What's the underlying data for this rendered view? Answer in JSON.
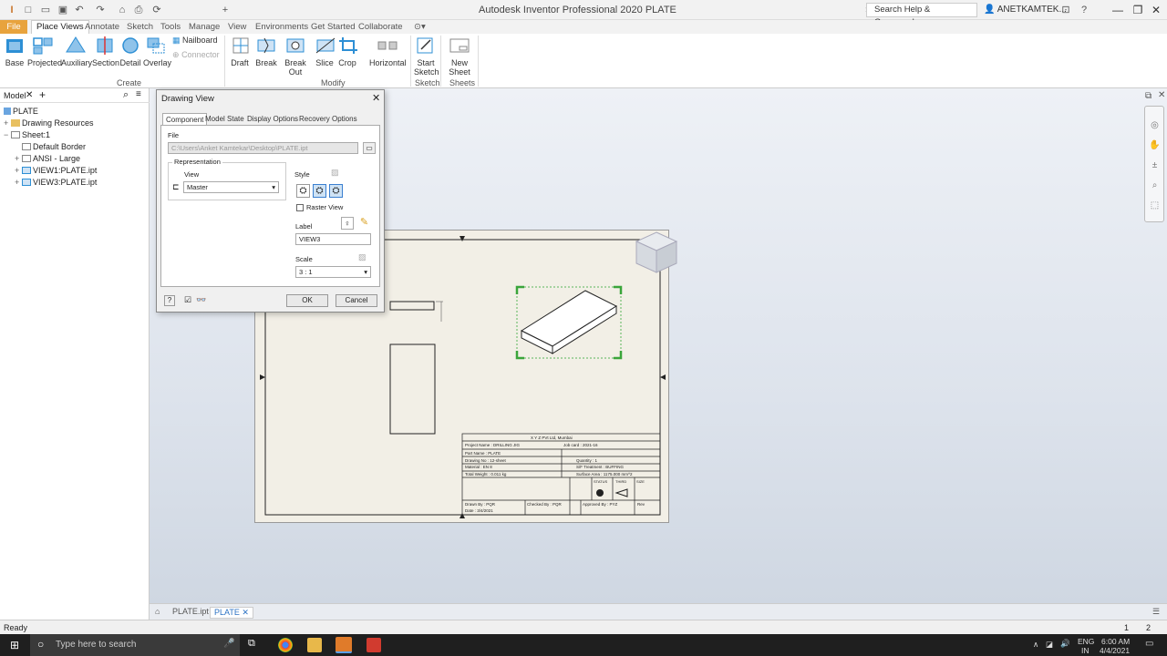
{
  "window": {
    "title": "Autodesk Inventor Professional 2020   PLATE",
    "help_search_placeholder": "Search Help & Commands...",
    "user": "ANETKAMTEK...",
    "minimize": "—",
    "restore": "❐",
    "close": "✕"
  },
  "ribbon_tabs": [
    "File",
    "Place Views",
    "Annotate",
    "Sketch",
    "Tools",
    "Manage",
    "View",
    "Environments",
    "Get Started",
    "Collaborate"
  ],
  "ribbon": {
    "create": {
      "title": "Create",
      "buttons": [
        "Base",
        "Projected",
        "Auxiliary",
        "Section",
        "Detail",
        "Overlay"
      ],
      "small": [
        "Nailboard",
        "Connector"
      ]
    },
    "modify": {
      "title": "Modify",
      "buttons": [
        "Draft",
        "Break",
        "Break Out",
        "Slice",
        "Crop",
        "Horizontal"
      ]
    },
    "sketch": {
      "title": "Sketch",
      "buttons": [
        "Start Sketch"
      ]
    },
    "sheets": {
      "title": "Sheets",
      "buttons": [
        "New Sheet"
      ]
    }
  },
  "browser": {
    "tab": "Model",
    "close": "✕",
    "add": "+",
    "items": [
      {
        "label": "PLATE",
        "expander": ""
      },
      {
        "label": "Drawing Resources",
        "expander": "+"
      },
      {
        "label": "Sheet:1",
        "expander": "−"
      },
      {
        "label": "Default Border",
        "expander": ""
      },
      {
        "label": "ANSI - Large",
        "expander": "+"
      },
      {
        "label": "VIEW1:PLATE.ipt",
        "expander": "+"
      },
      {
        "label": "VIEW3:PLATE.ipt",
        "expander": "+"
      }
    ]
  },
  "dialog": {
    "title": "Drawing View",
    "close": "✕",
    "tabs": [
      "Component",
      "Model State",
      "Display Options",
      "Recovery Options"
    ],
    "file_label": "File",
    "file_path": "C:\\Users\\Anket Kamtekar\\Desktop\\PLATE.ipt",
    "representation_label": "Representation",
    "view_label": "View",
    "view_value": "Master",
    "style_label": "Style",
    "raster_view": "Raster View",
    "label_label": "Label",
    "label_value": "VIEW3",
    "scale_label": "Scale",
    "scale_value": "3 : 1",
    "ok": "OK",
    "cancel": "Cancel"
  },
  "title_block": {
    "company": "X Y Z PVt Ltd, Mumbai",
    "project_name": "Project Name : DRILLING JIG",
    "job_card": "Job card : 2021-16",
    "part_name": "Part Name : PLATE",
    "drawing_no": "Drawing No : 12-sheet",
    "quantity": "Quantity : 1",
    "material": "Material : EN 8",
    "surface_treatment": "S/F Treatment : BUFFING",
    "total_weight": "Total Weight : 0.011 kg",
    "surface_area": "Surface Area : 1175.000 mm^2",
    "status": "STATUS",
    "third": "THIRD",
    "size": "SIZE",
    "drawn_by": "Drawn By : PQR",
    "checked_by": "Checked By : PQR",
    "approved_by": "Approved By : PYZ",
    "rev": "Rev",
    "date": "Date : 3/4/2021"
  },
  "doc_tabs": [
    "PLATE.ipt",
    "PLATE"
  ],
  "status": {
    "text": "Ready",
    "page_a": "1",
    "page_b": "2"
  },
  "taskbar": {
    "search_placeholder": "Type here to search",
    "lang": "ENG",
    "region": "IN",
    "time": "6:00 AM",
    "date": "4/4/2021"
  }
}
